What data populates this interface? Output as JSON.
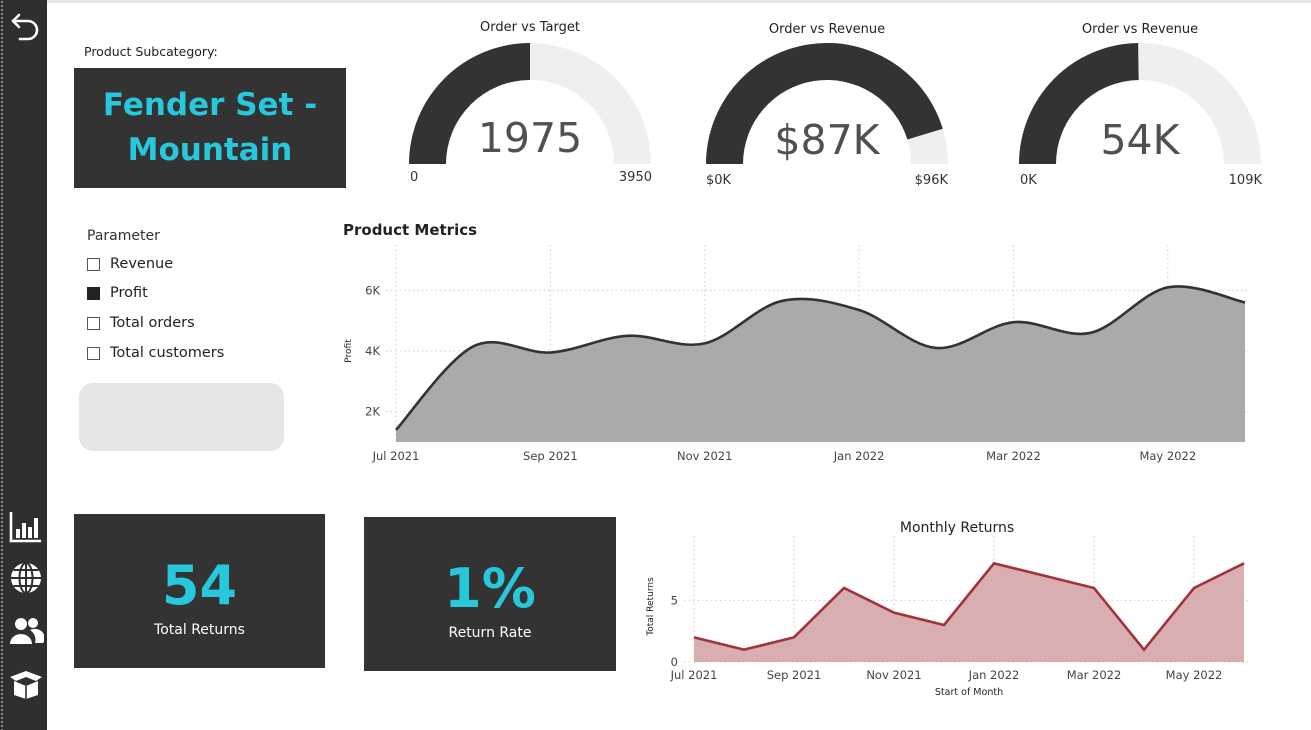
{
  "nav": {
    "back_icon": "back-arrow-icon",
    "items": [
      {
        "icon": "bar-chart-icon"
      },
      {
        "icon": "globe-icon"
      },
      {
        "icon": "users-icon"
      },
      {
        "icon": "product-box-icon"
      }
    ]
  },
  "subcategory": {
    "label": "Product Subcategory:",
    "value": "Fender Set - Mountain"
  },
  "gauges": [
    {
      "title": "Order vs Target",
      "value": "1975",
      "min": "0",
      "max": "3950",
      "fraction": 0.5
    },
    {
      "title": "Order vs Revenue",
      "value": "$87K",
      "min": "$0K",
      "max": "$96K",
      "fraction": 0.906
    },
    {
      "title": "Order vs Revenue",
      "value": "54K",
      "min": "0K",
      "max": "109K",
      "fraction": 0.495
    }
  ],
  "parameter": {
    "title": "Parameter",
    "options": [
      {
        "label": "Revenue",
        "checked": false
      },
      {
        "label": "Profit",
        "checked": true
      },
      {
        "label": "Total orders",
        "checked": false
      },
      {
        "label": "Total customers",
        "checked": false
      }
    ]
  },
  "kpis": {
    "returns": {
      "value": "54",
      "label": "Total Returns"
    },
    "rate": {
      "value": "1%",
      "label": "Return Rate"
    }
  },
  "colors": {
    "panel": "#333333",
    "accent": "#28c8dc",
    "area_fill": "#aaaaaa",
    "area_line": "#333333",
    "returns_line": "#a2333a",
    "returns_fill": "#d9aeb1"
  },
  "chart_data": [
    {
      "type": "area",
      "title": "Product Metrics",
      "xlabel": "",
      "ylabel": "Profit",
      "x": [
        "2021-07",
        "2021-08",
        "2021-09",
        "2021-10",
        "2021-11",
        "2021-12",
        "2022-01",
        "2022-02",
        "2022-03",
        "2022-04",
        "2022-05",
        "2022-06"
      ],
      "values": [
        1400,
        4150,
        3950,
        4500,
        4250,
        5650,
        5350,
        4100,
        4950,
        4600,
        6100,
        5600
      ],
      "x_ticks": [
        "Jul 2021",
        "Sep 2021",
        "Nov 2021",
        "Jan 2022",
        "Mar 2022",
        "May 2022"
      ],
      "y_ticks": [
        "2K",
        "4K",
        "6K"
      ],
      "ylim": [
        1000,
        7000
      ],
      "grid": true
    },
    {
      "type": "area",
      "title": "Monthly Returns",
      "xlabel": "Start of Month",
      "ylabel": "Total Returns",
      "x": [
        "2021-07",
        "2021-08",
        "2021-09",
        "2021-10",
        "2021-11",
        "2021-12",
        "2022-01",
        "2022-02",
        "2022-03",
        "2022-04",
        "2022-05",
        "2022-06"
      ],
      "values": [
        2,
        1,
        2,
        6,
        4,
        3,
        8,
        7,
        6,
        1,
        6,
        8
      ],
      "x_ticks": [
        "Jul 2021",
        "Sep 2021",
        "Nov 2021",
        "Jan 2022",
        "Mar 2022",
        "May 2022"
      ],
      "y_ticks": [
        "0",
        "5"
      ],
      "ylim": [
        0,
        9
      ],
      "grid": true
    }
  ]
}
